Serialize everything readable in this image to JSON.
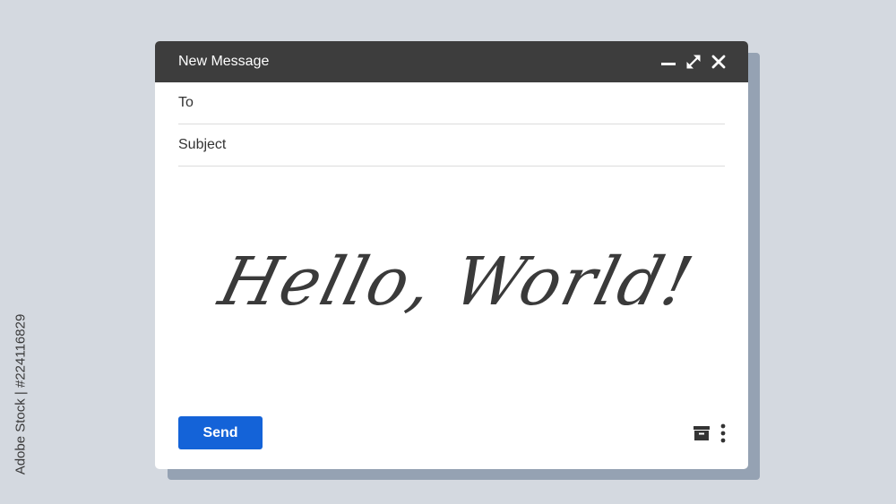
{
  "watermark": {
    "text": "Adobe Stock | #224116829"
  },
  "window": {
    "title": "New Message",
    "controls": [
      "minimize-icon",
      "expand-icon",
      "close-icon"
    ]
  },
  "compose": {
    "to_label": "To",
    "to_value": "",
    "subject_label": "Subject",
    "subject_value": "",
    "body_text": "Hello, World!"
  },
  "footer": {
    "send_label": "Send",
    "icons": [
      "archive-icon",
      "more-options-icon"
    ]
  },
  "colors": {
    "background": "#d4d9e0",
    "shadow": "#95a2b3",
    "titlebar": "#3d3d3d",
    "send_button": "#1463d8",
    "handwriting": "#3a3a3a"
  }
}
